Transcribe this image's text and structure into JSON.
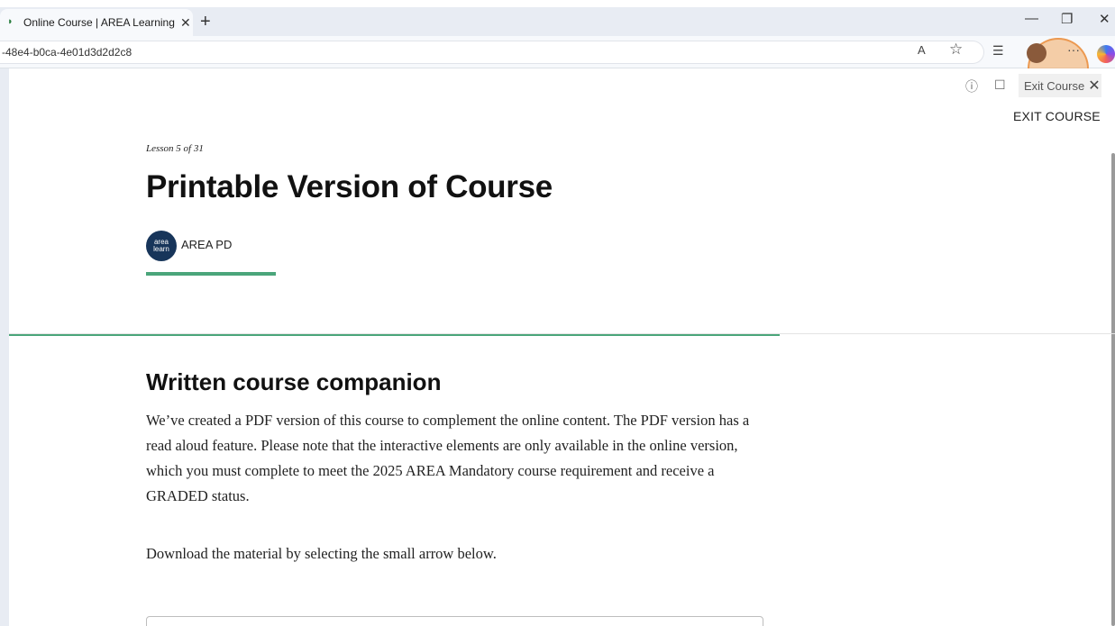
{
  "browser": {
    "tab": {
      "title": "Online Course | AREA Learning M",
      "close": "✕",
      "favicon": "audio-icon"
    },
    "new_tab": "+",
    "window": {
      "minimize": "—",
      "restore": "❐",
      "close": "✕"
    },
    "url": "-48e4-b0ca-4e01d3d2d2c8",
    "toolbar_icons": {
      "read_aloud": "A",
      "favorite": "☆",
      "favorites_bar": "☰",
      "more": "···"
    }
  },
  "course_header": {
    "info_icon": "ⓘ",
    "fullscreen_icon": "☐",
    "exit_chip_label": "Exit Course",
    "exit_chip_close": "✕",
    "exit_course_label": "EXIT COURSE"
  },
  "lesson": {
    "count": "Lesson 5 of 31",
    "title": "Printable Version of Course",
    "author_logo_text": "area learn",
    "author": "AREA PD",
    "progress_fraction": 0.697
  },
  "section": {
    "heading": "Written course companion",
    "paragraph": "We’ve created a PDF version of this course to complement the online content. The PDF version has a read aloud feature. Please note that the interactive elements are only available in the online version, which you must complete to meet the 2025 AREA Mandatory course requirement and receive a GRADED status.",
    "download_instruction": "Download the material by selecting the small arrow below."
  },
  "colors": {
    "accent": "#4aa57a",
    "author_badge": "#17355a",
    "highlight": "#f3aa60"
  }
}
